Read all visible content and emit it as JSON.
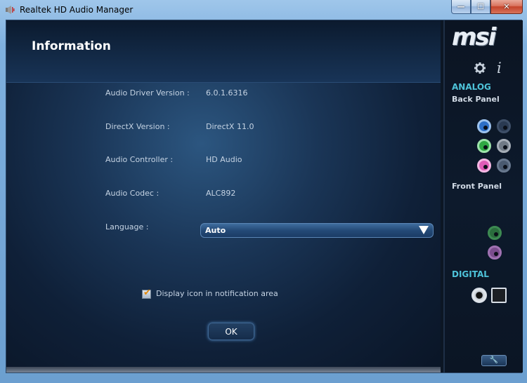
{
  "window": {
    "title": "Realtek HD Audio Manager",
    "caption": {
      "minimize": "—",
      "maximize": "☐",
      "close": "✕"
    }
  },
  "page": {
    "title": "Information"
  },
  "info": [
    {
      "label": "Audio Driver Version :",
      "value": "6.0.1.6316"
    },
    {
      "label": "DirectX Version :",
      "value": "DirectX 11.0"
    },
    {
      "label": "Audio Controller :",
      "value": "HD Audio"
    },
    {
      "label": "Audio Codec :",
      "value": "ALC892"
    }
  ],
  "language": {
    "label": "Language :",
    "selected": "Auto"
  },
  "notification": {
    "label": "Display icon in notification area",
    "checked": true
  },
  "ok": {
    "label": "OK"
  },
  "side": {
    "logo": "msi",
    "analog": "ANALOG",
    "back_panel": "Back Panel",
    "front_panel": "Front Panel",
    "digital": "DIGITAL",
    "jack_colors": {
      "blue": "#2d6fc7",
      "green": "#2fa843",
      "pink": "#e05bb7",
      "gray": "#707a86",
      "front_green": "#2a6d3d",
      "front_pink": "#7b4d8e"
    }
  }
}
